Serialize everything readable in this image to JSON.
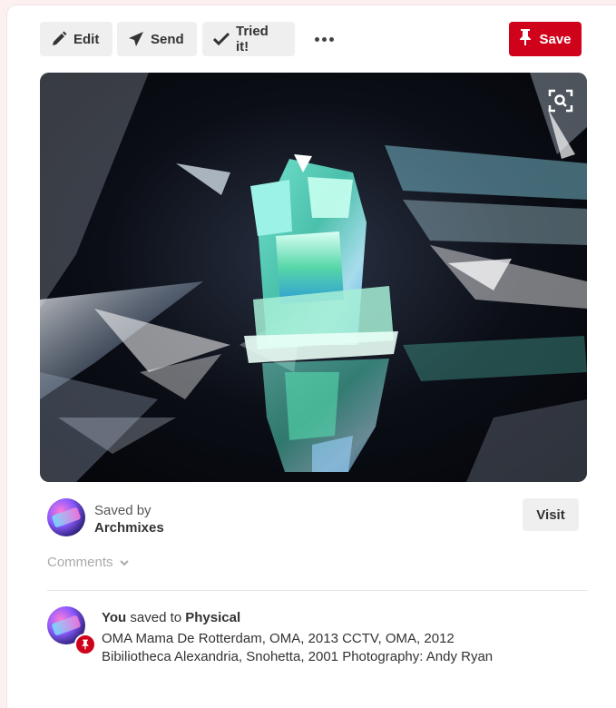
{
  "toolbar": {
    "edit_label": "Edit",
    "send_label": "Send",
    "tried_label": "Tried it!",
    "save_label": "Save",
    "more_icon": "ellipsis-icon"
  },
  "colors": {
    "save_red": "#d0021b",
    "button_gray": "#efefef"
  },
  "pin": {
    "image_alt": "Iridescent architectural model on reflective foil",
    "saved_by_prefix": "Saved by",
    "saved_by_name": "Archmixes",
    "visit_label": "Visit",
    "comments_label": "Comments"
  },
  "activity": {
    "actor": "You",
    "verb": " saved to ",
    "board": "Physical",
    "description": "OMA Mama De Rotterdam, OMA, 2013 CCTV, OMA, 2012 Bibiliotheca Alexandria, Snohetta, 2001 Photography: Andy Ryan"
  }
}
